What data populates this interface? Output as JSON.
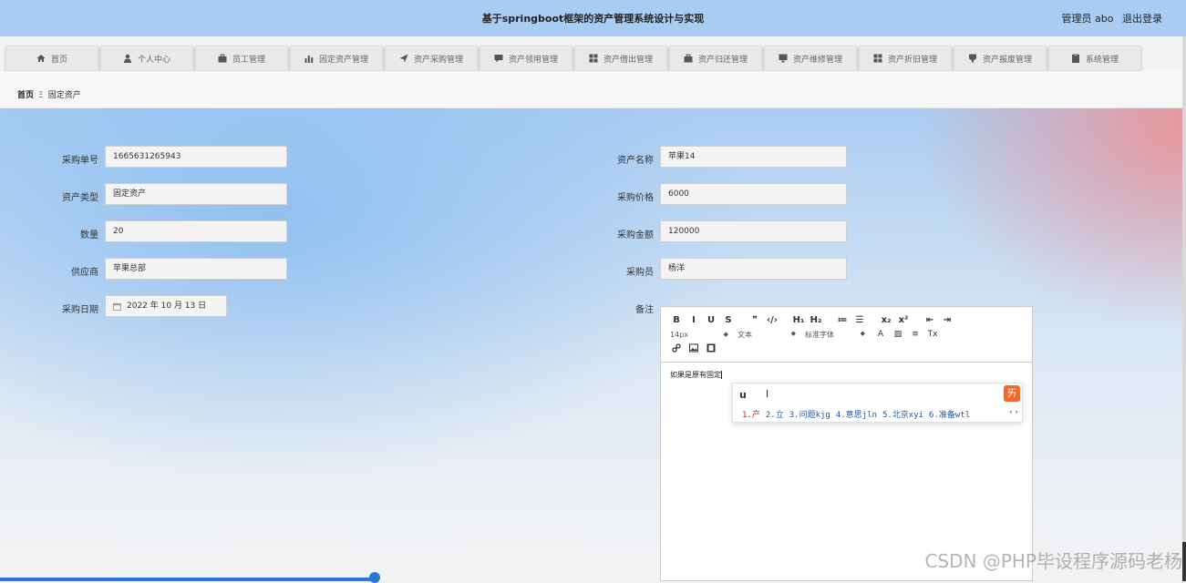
{
  "header": {
    "title": "基于springboot框架的资产管理系统设计与实现",
    "user_label": "管理员 abo",
    "logout": "退出登录"
  },
  "nav": {
    "items": [
      {
        "label": "首页",
        "icon": "home-icon"
      },
      {
        "label": "个人中心",
        "icon": "user-icon"
      },
      {
        "label": "员工管理",
        "icon": "briefcase-icon"
      },
      {
        "label": "固定资产管理",
        "icon": "bar-chart-icon"
      },
      {
        "label": "资产采购管理",
        "icon": "send-icon"
      },
      {
        "label": "资产领用管理",
        "icon": "comment-icon"
      },
      {
        "label": "资产借出管理",
        "icon": "grid-icon"
      },
      {
        "label": "资产归还管理",
        "icon": "briefcase-icon"
      },
      {
        "label": "资产维修管理",
        "icon": "monitor-icon"
      },
      {
        "label": "资产折旧管理",
        "icon": "grid-icon"
      },
      {
        "label": "资产报废管理",
        "icon": "trophy-icon"
      },
      {
        "label": "系统管理",
        "icon": "clipboard-icon"
      }
    ]
  },
  "breadcrumb": {
    "home": "首页",
    "separator": "Ξ",
    "current": "固定资产"
  },
  "form": {
    "caigou_danhao": {
      "label": "采购单号",
      "value": "1665631265943"
    },
    "zichan_leixing": {
      "label": "资产类型",
      "value": "固定资产"
    },
    "shuliang": {
      "label": "数量",
      "value": "20"
    },
    "gongyingshang": {
      "label": "供应商",
      "value": "苹果总部"
    },
    "caigou_riqi": {
      "label": "采购日期",
      "value": "2022 年 10 月 13 日"
    },
    "zichan_mingcheng": {
      "label": "资产名称",
      "value": "苹果14"
    },
    "caigou_jiage": {
      "label": "采购价格",
      "value": "6000"
    },
    "caigou_jine": {
      "label": "采购金额",
      "value": "120000"
    },
    "caigouyuan": {
      "label": "采购员",
      "value": "杨洋"
    },
    "beizhu": {
      "label": "备注",
      "content": "如果是原有固定"
    }
  },
  "editor_toolbar": {
    "row1": [
      "B",
      "I",
      "U",
      "S",
      "❞",
      "‹/›",
      "H₁",
      "H₂",
      "≔",
      "☰",
      "x₂",
      "x²",
      "⇤",
      "⇥"
    ],
    "font_size": "14px",
    "text_style": "文本",
    "font_family": "标准字体",
    "row2_tail": [
      "A",
      "▨",
      "≡",
      "Tx"
    ],
    "row3": [
      "link-icon",
      "image-icon",
      "video-icon"
    ]
  },
  "ime": {
    "typed": "u",
    "candidates": [
      {
        "num": "1.",
        "text": "产"
      },
      {
        "num": "2.",
        "text": "立"
      },
      {
        "num": "3.",
        "text": "问题kjg"
      },
      {
        "num": "4.",
        "text": "意思jln"
      },
      {
        "num": "5.",
        "text": "北京xyi"
      },
      {
        "num": "6.",
        "text": "准备wtl"
      }
    ]
  },
  "watermark": "CSDN @PHP毕设程序源码老杨",
  "colors": {
    "header_bg": "#a9cdf2",
    "accent": "#2b78d6",
    "ime_logo": "#f06a2a"
  }
}
